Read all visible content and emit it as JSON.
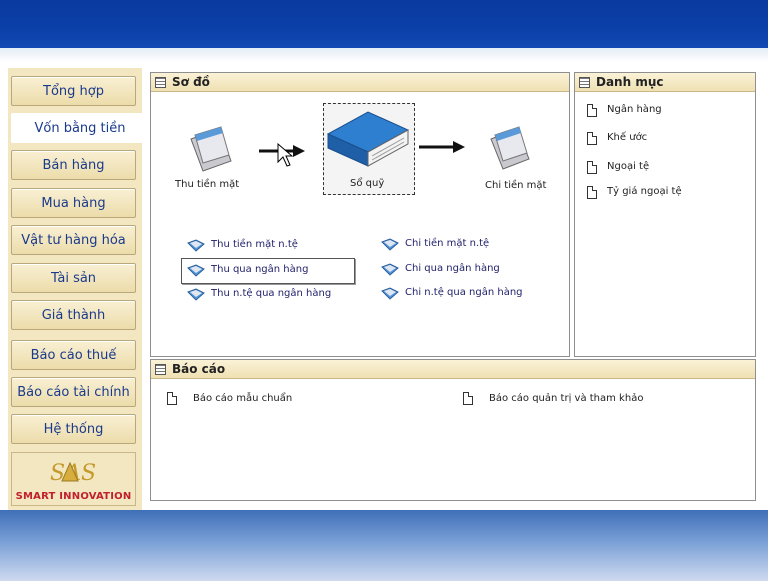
{
  "sidebar": {
    "items": [
      {
        "label": "Tổng hợp"
      },
      {
        "label": "Vốn bằng tiền"
      },
      {
        "label": "Bán hàng"
      },
      {
        "label": "Mua hàng"
      },
      {
        "label": "Vật tư hàng hóa"
      },
      {
        "label": "Tài sản"
      },
      {
        "label": "Giá thành"
      },
      {
        "label": "Báo cáo thuế"
      },
      {
        "label": "Báo cáo tài chính"
      },
      {
        "label": "Hệ thống"
      }
    ],
    "logo_text": "SMART INNOVATION",
    "logo_letters": "SAS"
  },
  "so_do": {
    "title": "Sơ đồ",
    "flow": {
      "left": "Thu tiền mặt",
      "center": "Sổ quỹ",
      "right": "Chi tiền mặt"
    },
    "links_left": [
      "Thu tiền mặt n.tệ",
      "Thu qua ngân hàng",
      "Thu n.tệ qua ngân hàng"
    ],
    "links_right": [
      "Chi tiền mặt n.tệ",
      "Chi qua ngân hàng",
      "Chi n.tệ qua ngân hàng"
    ]
  },
  "danh_muc": {
    "title": "Danh mục",
    "items": [
      "Ngân hàng",
      "Khế ước",
      "Ngoại tệ",
      "Tỷ giá ngoại tệ"
    ]
  },
  "bao_cao": {
    "title": "Báo cáo",
    "items": [
      "Báo cáo mẫu chuẩn",
      "Báo cáo quản trị và tham khảo"
    ]
  },
  "colors": {
    "banner": "#0b3fa8",
    "sidebar": "#f3e7c2",
    "link_text": "#1f1f6a",
    "logo_text": "#c0202a"
  }
}
